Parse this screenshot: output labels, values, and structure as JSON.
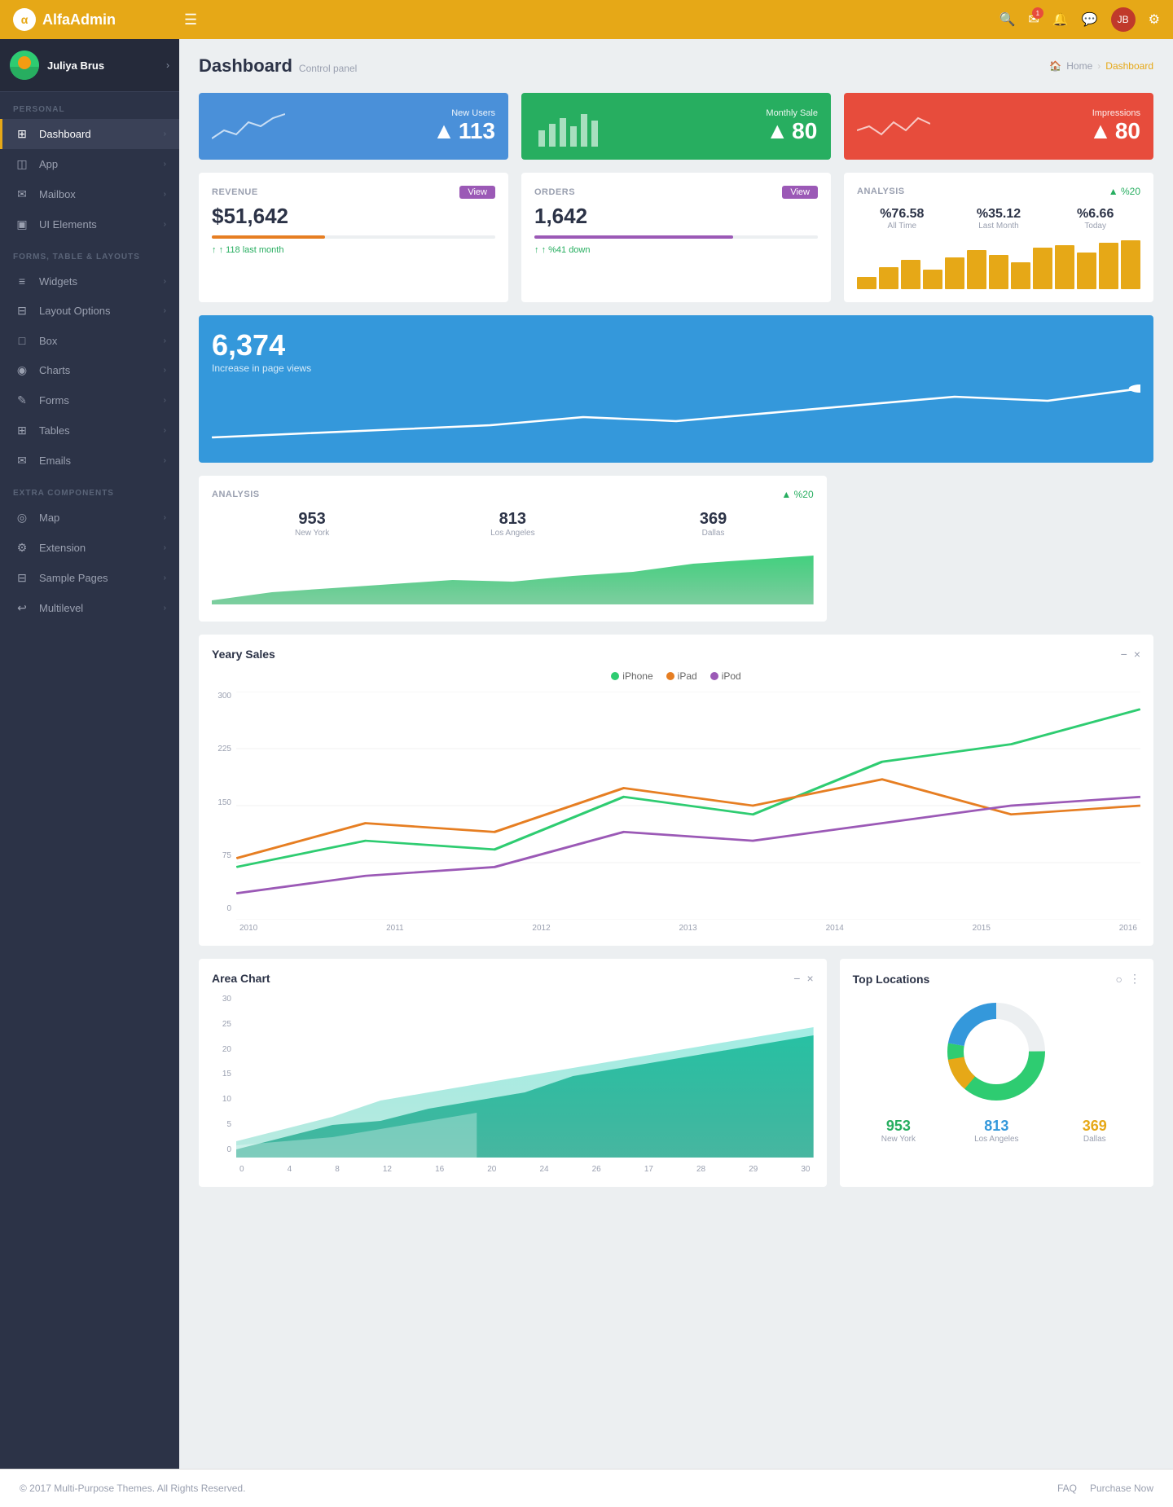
{
  "brand": {
    "logo_letter": "α",
    "name_prefix": "Alfa",
    "name_suffix": "Admin"
  },
  "topnav": {
    "menu_icon": "☰",
    "search_icon": "🔍",
    "bell_icon": "🔔",
    "mail_icon": "✉",
    "chat_icon": "💬",
    "settings_icon": "⚙",
    "badge_count": "1",
    "avatar_initials": "JB"
  },
  "sidebar": {
    "user_name": "Juliya Brus",
    "sections": [
      {
        "label": "PERSONAL",
        "items": [
          {
            "icon": "⊞",
            "label": "Dashboard",
            "active": true
          },
          {
            "icon": "◫",
            "label": "App",
            "active": false
          },
          {
            "icon": "✉",
            "label": "Mailbox",
            "active": false
          },
          {
            "icon": "▣",
            "label": "UI Elements",
            "active": false
          }
        ]
      },
      {
        "label": "FORMS, TABLE & LAYOUTS",
        "items": [
          {
            "icon": "≡",
            "label": "Widgets",
            "active": false
          },
          {
            "icon": "⊟",
            "label": "Layout Options",
            "active": false
          },
          {
            "icon": "□",
            "label": "Box",
            "active": false
          },
          {
            "icon": "◉",
            "label": "Charts",
            "active": false
          },
          {
            "icon": "✎",
            "label": "Forms",
            "active": false
          },
          {
            "icon": "⊞",
            "label": "Tables",
            "active": false
          },
          {
            "icon": "✉",
            "label": "Emails",
            "active": false
          }
        ]
      },
      {
        "label": "EXTRA COMPONENTS",
        "items": [
          {
            "icon": "◎",
            "label": "Map",
            "active": false
          },
          {
            "icon": "⚙",
            "label": "Extension",
            "active": false
          },
          {
            "icon": "⊟",
            "label": "Sample Pages",
            "active": false
          },
          {
            "icon": "↩",
            "label": "Multilevel",
            "active": false
          }
        ]
      }
    ]
  },
  "page": {
    "title": "Dashboard",
    "subtitle": "Control panel",
    "breadcrumb_home": "Home",
    "breadcrumb_current": "Dashboard"
  },
  "stat_cards": [
    {
      "id": "new-users",
      "bg": "blue",
      "label": "New Users",
      "value": "113",
      "arrow": "▲"
    },
    {
      "id": "monthly-sale",
      "bg": "green",
      "label": "Monthly Sale",
      "value": "80",
      "arrow": "▲"
    },
    {
      "id": "impressions",
      "bg": "red",
      "label": "Impressions",
      "value": "80",
      "arrow": "▲"
    }
  ],
  "revenue": {
    "label": "REVENUE",
    "button_label": "View",
    "value": "$51,642",
    "bar_width_pct": 40,
    "footer_text": "↑ 118 last month"
  },
  "orders": {
    "label": "ORDERS",
    "button_label": "View",
    "value": "1,642",
    "bar_width_pct": 70,
    "footer_text": "↑ %41 down"
  },
  "analysis_top": {
    "label": "ANALYSIS",
    "change": "▲ %20",
    "stats": [
      {
        "value": "%76.58",
        "label": "All Time"
      },
      {
        "value": "%35.12",
        "label": "Last Month"
      },
      {
        "value": "%6.66",
        "label": "Today"
      }
    ],
    "bars": [
      20,
      35,
      45,
      30,
      50,
      60,
      55,
      40,
      65,
      70,
      60,
      75,
      80
    ]
  },
  "page_views": {
    "value": "6,374",
    "label": "Increase in page views"
  },
  "analysis_bottom": {
    "label": "ANALYSIS",
    "change": "▲ %20",
    "stats": [
      {
        "value": "953",
        "label": "New York"
      },
      {
        "value": "813",
        "label": "Los Angeles"
      },
      {
        "value": "369",
        "label": "Dallas"
      }
    ]
  },
  "yearly_sales": {
    "title": "Yeary Sales",
    "legend": [
      {
        "color": "#2ecc71",
        "label": "iPhone"
      },
      {
        "color": "#e67e22",
        "label": "iPad"
      },
      {
        "color": "#9b59b6",
        "label": "iPod"
      }
    ],
    "y_labels": [
      "300",
      "225",
      "150",
      "75",
      "0"
    ],
    "x_labels": [
      "2010",
      "2011",
      "2012",
      "2013",
      "2014",
      "2015",
      "2016"
    ]
  },
  "area_chart": {
    "title": "Area Chart",
    "y_labels": [
      "30",
      "25",
      "20",
      "15",
      "10",
      "5",
      "0"
    ],
    "x_labels": [
      "0",
      "4",
      "8",
      "12",
      "16",
      "20",
      "24",
      "26",
      "17",
      "28",
      "29",
      "30"
    ]
  },
  "top_locations": {
    "title": "Top Locations",
    "stats": [
      {
        "value": "953",
        "label": "New York",
        "color_class": "green"
      },
      {
        "value": "813",
        "label": "Los Angeles",
        "color_class": "blue"
      },
      {
        "value": "369",
        "label": "Dallas",
        "color_class": "yellow"
      }
    ]
  },
  "footer": {
    "copyright": "© 2017 Multi-Purpose Themes. All Rights Reserved.",
    "links": [
      {
        "label": "FAQ"
      },
      {
        "label": "Purchase Now"
      }
    ]
  }
}
